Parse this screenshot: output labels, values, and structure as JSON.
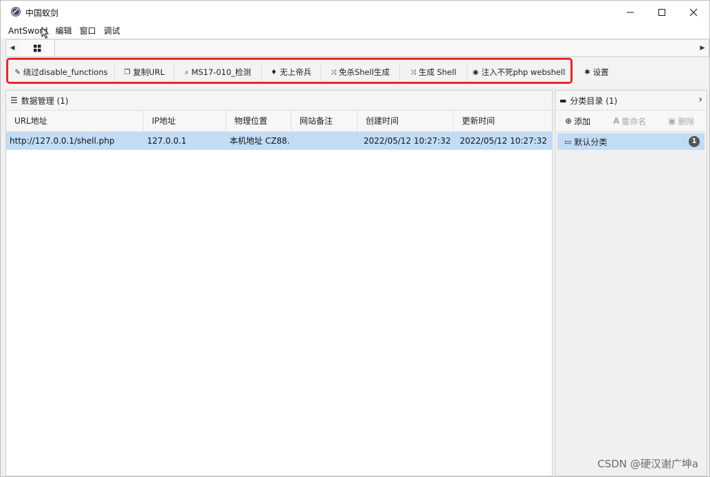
{
  "window": {
    "title": "中国蚁剑"
  },
  "menu": [
    "AntSword",
    "编辑",
    "窗口",
    "调试"
  ],
  "toolbar": {
    "buttons": [
      {
        "label": "绕过disable_functions",
        "icon": "plug-icon"
      },
      {
        "label": "复制URL",
        "icon": "copy-icon"
      },
      {
        "label": "MS17-010_检测",
        "icon": "search-icon"
      },
      {
        "label": "无上帝兵",
        "icon": "sword-icon"
      },
      {
        "label": "免杀Shell生成",
        "icon": "shuffle-icon"
      },
      {
        "label": "生成 Shell",
        "icon": "shuffle-icon"
      },
      {
        "label": "注入不死php webshell",
        "icon": "eye-icon"
      }
    ],
    "settings_label": "设置",
    "highlight_color": "#e8262b"
  },
  "data_panel": {
    "title": "数据管理 (1)",
    "columns": [
      "URL地址",
      "IP地址",
      "物理位置",
      "网站备注",
      "创建时间",
      "更新时间"
    ],
    "rows": [
      {
        "url": "http://127.0.0.1/shell.php",
        "ip": "127.0.0.1",
        "location": "本机地址 CZ88.",
        "note": "",
        "created": "2022/05/12 10:27:32",
        "updated": "2022/05/12 10:27:32"
      }
    ],
    "selected_row_color": "#c2dcf6"
  },
  "category_panel": {
    "title": "分类目录 (1)",
    "add_label": "添加",
    "rename_label": "重命名",
    "delete_label": "删除",
    "items": [
      {
        "label": "默认分类",
        "count": "1"
      }
    ]
  },
  "watermark": "CSDN @硬汉谢广坤a"
}
